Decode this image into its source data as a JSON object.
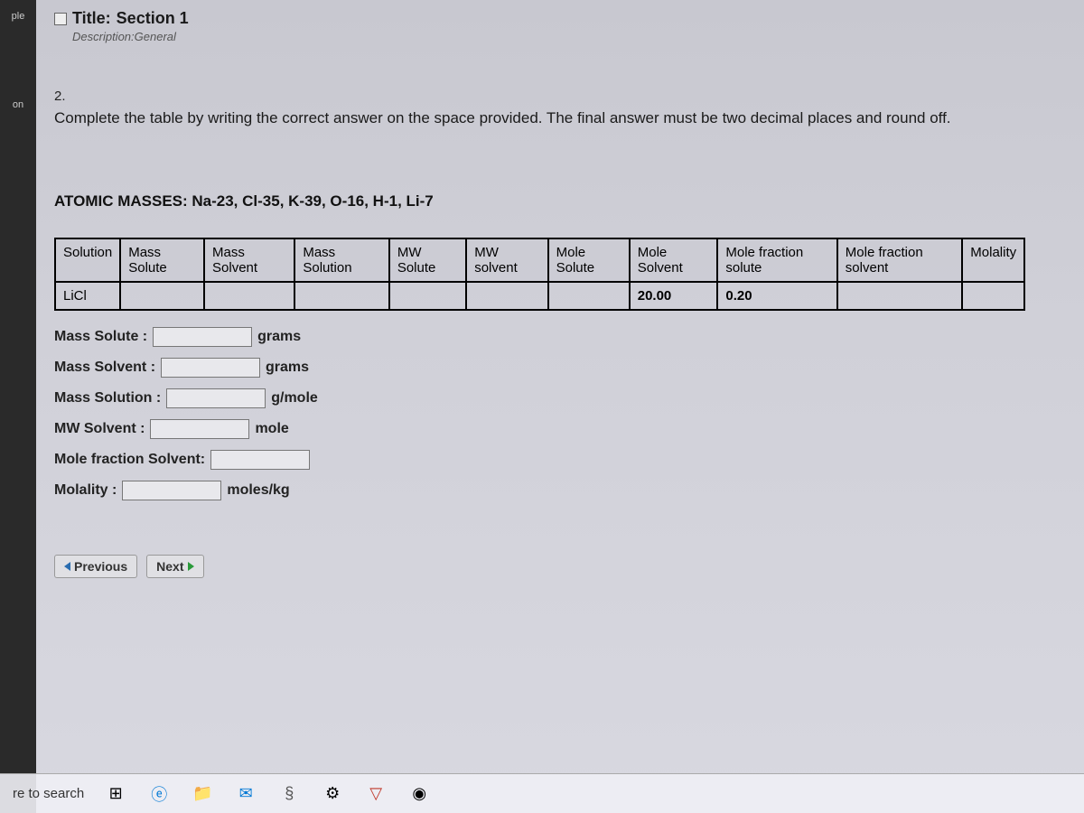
{
  "sidebar": {
    "tab_top": "ple",
    "tab_mid": "on"
  },
  "header": {
    "title_label": "Title:",
    "title_value": "Section 1",
    "description_label": "Description:",
    "description_value": "General"
  },
  "question": {
    "number": "2.",
    "text": "Complete the table by writing the correct answer on the space provided. The final answer must be two decimal places and round off."
  },
  "atomic_masses": "ATOMIC MASSES: Na-23, Cl-35, K-39, O-16, H-1, Li-7",
  "table": {
    "headers": [
      "Solution",
      "Mass Solute",
      "Mass Solvent",
      "Mass Solution",
      "MW Solute",
      "MW solvent",
      "Mole Solute",
      "Mole Solvent",
      "Mole fraction solute",
      "Mole fraction solvent",
      "Molality"
    ],
    "rows": [
      {
        "solution": "LiCl",
        "mass_solute": "",
        "mass_solvent": "",
        "mass_solution": "",
        "mw_solute": "",
        "mw_solvent": "",
        "mole_solute": "",
        "mole_solvent": "20.00",
        "mf_solute": "0.20",
        "mf_solvent": "",
        "molality": ""
      }
    ]
  },
  "inputs": [
    {
      "label": "Mass Solute :",
      "unit": "grams"
    },
    {
      "label": "Mass Solvent :",
      "unit": "grams"
    },
    {
      "label": "Mass Solution :",
      "unit": "g/mole"
    },
    {
      "label": "MW Solvent :",
      "unit": "mole"
    },
    {
      "label": "Mole fraction Solvent:",
      "unit": ""
    },
    {
      "label": "Molality :",
      "unit": "moles/kg"
    }
  ],
  "nav": {
    "previous": "Previous",
    "next": "Next"
  },
  "taskbar": {
    "search": "re to search"
  }
}
